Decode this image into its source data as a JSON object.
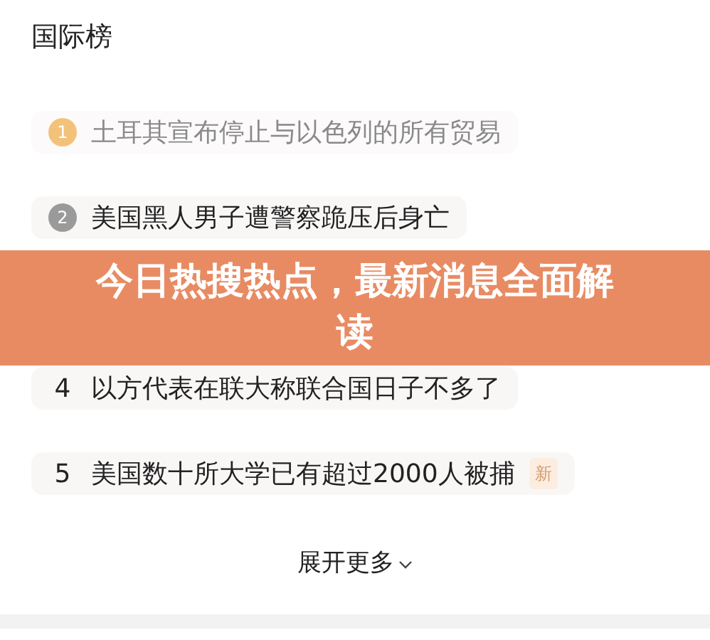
{
  "section": {
    "title": "国际榜"
  },
  "items": [
    {
      "rank": "1",
      "kind": "medal",
      "color": "#f3c27a",
      "title": "土耳其宣布停止与以色列的所有贸易",
      "dimmed": true
    },
    {
      "rank": "2",
      "kind": "medal",
      "color": "#9a9a9a",
      "title": "美国黑人男子遭警察跪压后身亡",
      "dimmed": false
    },
    {
      "kind": "hidden"
    },
    {
      "rank": "4",
      "kind": "plain",
      "title": "以方代表在联大称联合国日子不多了",
      "dimmed": false
    },
    {
      "rank": "5",
      "kind": "plain",
      "title": "美国数十所大学已有超过2000人被捕",
      "tag": "新",
      "dimmed": false
    }
  ],
  "more": {
    "label": "展开更多"
  },
  "banner": {
    "headline": "今日热搜热点，最新消息全面解读"
  }
}
